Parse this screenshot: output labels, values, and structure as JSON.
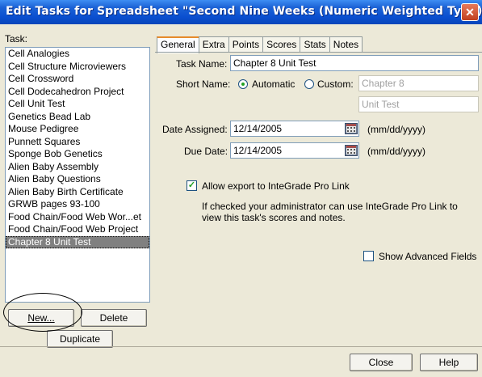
{
  "window": {
    "title": "Edit Tasks for Spreadsheet \"Second Nine Weeks (Numeric Weighted Type)\""
  },
  "left": {
    "label": "Task:",
    "items": [
      "Cell Analogies",
      "Cell Structure Microviewers",
      "Cell Crossword",
      "Cell Dodecahedron Project",
      "Cell Unit Test",
      "Genetics Bead Lab",
      "Mouse Pedigree",
      "Punnett Squares",
      "Sponge Bob Genetics",
      "Alien Baby Assembly",
      "Alien Baby Questions",
      "Alien Baby Birth Certificate",
      "GRWB pages 93-100",
      "Food Chain/Food Web Wor...et",
      "Food Chain/Food Web Project",
      "Chapter 8 Unit Test"
    ],
    "selected_index": 15,
    "new_label": "New...",
    "delete_label": "Delete",
    "duplicate_label": "Duplicate"
  },
  "tabs": [
    "General",
    "Extra",
    "Points",
    "Scores",
    "Stats",
    "Notes"
  ],
  "active_tab": "General",
  "general": {
    "task_name_label": "Task Name:",
    "task_name_value": "Chapter 8 Unit Test",
    "short_name_label": "Short Name:",
    "automatic_label": "Automatic",
    "custom_label": "Custom:",
    "short_name_mode": "Automatic",
    "short_line1": "Chapter 8",
    "short_line2": "Unit Test",
    "date_assigned_label": "Date Assigned:",
    "date_assigned_value": "12/14/2005",
    "due_date_label": "Due Date:",
    "due_date_value": "12/14/2005",
    "date_format": "(mm/dd/yyyy)",
    "allow_export_label": "Allow export to InteGrade Pro Link",
    "allow_export_checked": true,
    "export_help_1": "If checked your administrator can use InteGrade Pro Link to",
    "export_help_2": "view this task's scores and notes.",
    "show_advanced_label": "Show Advanced Fields",
    "show_advanced_checked": false
  },
  "footer": {
    "close_label": "Close",
    "help_label": "Help"
  },
  "icons": {
    "close": "close-x-icon",
    "calendar": "calendar-icon"
  },
  "colors": {
    "titlebar": "#0a4fd0",
    "selection": "#808080",
    "active_tab_accent": "#e68b2c"
  }
}
